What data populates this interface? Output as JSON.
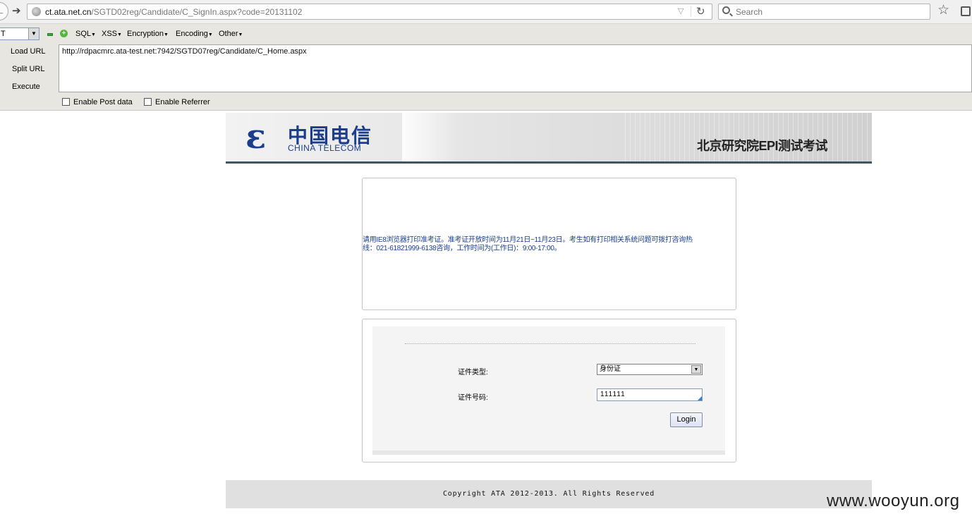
{
  "browser": {
    "url_host": "ct.ata.net.cn",
    "url_path": "/SGTD02reg/Candidate/C_SignIn.aspx?code=20131102",
    "search_placeholder": "Search"
  },
  "hackbar": {
    "select_value": "T",
    "menus": [
      "SQL",
      "XSS",
      "Encryption",
      "Encoding",
      "Other"
    ],
    "side_buttons": [
      "Load URL",
      "Split URL",
      "Execute"
    ],
    "url_value": "http://rdpacmrc.ata-test.net:7942/SGTD07reg/Candidate/C_Home.aspx",
    "checkbox_post": "Enable Post data",
    "checkbox_referrer": "Enable Referrer"
  },
  "banner": {
    "logo_cn": "中国电信",
    "logo_en": "CHINA TELECOM",
    "title": "北京研究院EPI测试考试"
  },
  "notice": {
    "line1": "请用IE8浏览器打印准考证。准考证开放时间为11月21日~11月23日。考生如有打印相关系统问题可拨打咨询热",
    "line2": "线：021-61821999-6138咨询，工作时间为(工作日)：9:00-17:00。"
  },
  "login": {
    "id_type_label": "证件类型:",
    "id_type_value": "身份证",
    "id_number_label": "证件号码:",
    "id_number_value": "111111",
    "button_label": "Login"
  },
  "footer": {
    "copyright": "Copyright ATA 2012-2013. All Rights Reserved"
  },
  "watermark": "www.wooyun.org",
  "colors": {
    "logo_blue": "#1b3d8c",
    "notice_blue": "#1a3f8f",
    "banner_rule": "#3b5667"
  }
}
